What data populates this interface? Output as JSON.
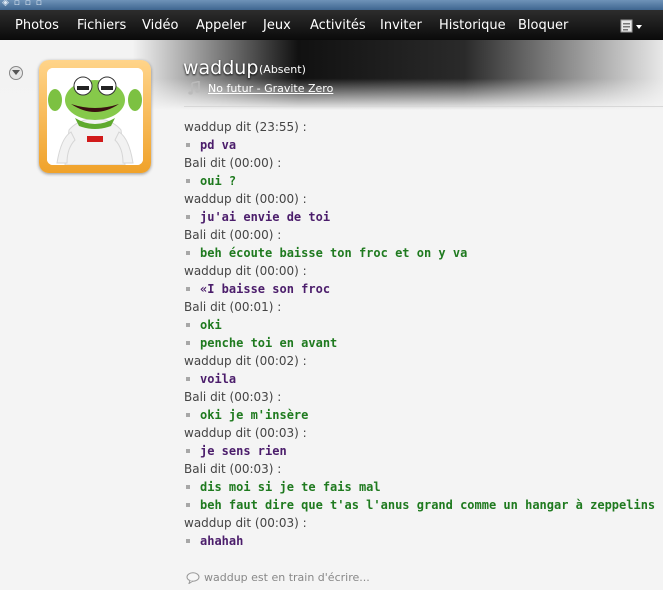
{
  "menu": [
    {
      "label": "Photos"
    },
    {
      "label": "Fichiers"
    },
    {
      "label": "Vidéo"
    },
    {
      "label": "Appeler"
    },
    {
      "label": "Jeux"
    },
    {
      "label": "Activités"
    },
    {
      "label": "Inviter"
    },
    {
      "label": "Historique"
    },
    {
      "label": "Bloquer"
    }
  ],
  "contact": {
    "name": "waddup",
    "status": "(Absent)",
    "now_playing": "No futur - Gravite Zero"
  },
  "messages": [
    {
      "sender_line": "waddup dit (23:55) :",
      "color": "#4b1d6b",
      "lines": [
        "pd va"
      ]
    },
    {
      "sender_line": "Bali dit (00:00) :",
      "color": "#1f7a1f",
      "lines": [
        "oui ?"
      ]
    },
    {
      "sender_line": "waddup dit (00:00) :",
      "color": "#4b1d6b",
      "lines": [
        "ju'ai envie de toi"
      ]
    },
    {
      "sender_line": "Bali dit (00:00) :",
      "color": "#1f7a1f",
      "lines": [
        "beh écoute baisse ton froc et on y va"
      ]
    },
    {
      "sender_line": "waddup dit (00:00) :",
      "color": "#4b1d6b",
      "lines": [
        "«I baisse son froc"
      ]
    },
    {
      "sender_line": "Bali dit (00:01) :",
      "color": "#1f7a1f",
      "lines": [
        "oki",
        "penche toi en avant"
      ]
    },
    {
      "sender_line": "waddup dit (00:02) :",
      "color": "#4b1d6b",
      "lines": [
        "voila"
      ]
    },
    {
      "sender_line": "Bali dit (00:03) :",
      "color": "#1f7a1f",
      "lines": [
        "oki je m'insère"
      ]
    },
    {
      "sender_line": "waddup dit (00:03) :",
      "color": "#4b1d6b",
      "lines": [
        "je sens rien"
      ]
    },
    {
      "sender_line": "Bali dit (00:03) :",
      "color": "#1f7a1f",
      "lines": [
        "dis moi si je te fais mal",
        "beh faut dire que t'as l'anus grand comme un hangar à zeppelins"
      ]
    },
    {
      "sender_line": "waddup dit (00:03) :",
      "color": "#4b1d6b",
      "lines": [
        "ahahah"
      ]
    }
  ],
  "typing_status": "waddup est en train d'écrire...",
  "colors": {
    "menubar": "#0a0a0a",
    "avatar_frame": "#f0a22a",
    "waddup_text": "#4b1d6b",
    "bali_text": "#1f7a1f"
  },
  "icons": {
    "music": "music-note-icon",
    "typing": "speech-bubble-icon",
    "collapse": "chevron-down-icon",
    "menu": "dropdown-menu-icon"
  }
}
